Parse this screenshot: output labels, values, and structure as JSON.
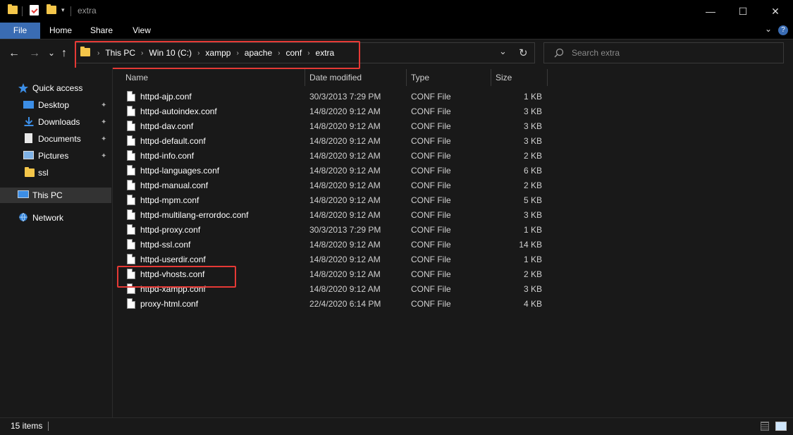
{
  "window": {
    "title": "extra",
    "minimize_glyph": "—",
    "maximize_glyph": "☐",
    "close_glyph": "✕"
  },
  "ribbon": {
    "tabs": [
      "File",
      "Home",
      "Share",
      "View"
    ],
    "expand_glyph": "⌄",
    "help_glyph": "?"
  },
  "address": {
    "crumbs": [
      "This PC",
      "Win 10 (C:)",
      "xampp",
      "apache",
      "conf",
      "extra"
    ],
    "refresh_glyph": "↻",
    "dropdown_glyph": "⌄"
  },
  "search": {
    "placeholder": "Search extra"
  },
  "nav": {
    "back": "←",
    "forward": "→",
    "recent": "⌄",
    "up": "↑"
  },
  "sidebar": {
    "quick_access": "Quick access",
    "items": [
      {
        "label": "Desktop",
        "icon": "desktop-icon",
        "pinned": true
      },
      {
        "label": "Downloads",
        "icon": "downloads-icon",
        "pinned": true
      },
      {
        "label": "Documents",
        "icon": "documents-icon",
        "pinned": true
      },
      {
        "label": "Pictures",
        "icon": "pictures-icon",
        "pinned": true
      },
      {
        "label": "ssl",
        "icon": "folder-icon",
        "pinned": false
      }
    ],
    "this_pc": "This PC",
    "network": "Network",
    "pin_glyph": "📌"
  },
  "columns": {
    "name": "Name",
    "date": "Date modified",
    "type": "Type",
    "size": "Size"
  },
  "files": [
    {
      "name": "httpd-ajp.conf",
      "date": "30/3/2013 7:29 PM",
      "type": "CONF File",
      "size": "1 KB"
    },
    {
      "name": "httpd-autoindex.conf",
      "date": "14/8/2020 9:12 AM",
      "type": "CONF File",
      "size": "3 KB"
    },
    {
      "name": "httpd-dav.conf",
      "date": "14/8/2020 9:12 AM",
      "type": "CONF File",
      "size": "3 KB"
    },
    {
      "name": "httpd-default.conf",
      "date": "14/8/2020 9:12 AM",
      "type": "CONF File",
      "size": "3 KB"
    },
    {
      "name": "httpd-info.conf",
      "date": "14/8/2020 9:12 AM",
      "type": "CONF File",
      "size": "2 KB"
    },
    {
      "name": "httpd-languages.conf",
      "date": "14/8/2020 9:12 AM",
      "type": "CONF File",
      "size": "6 KB"
    },
    {
      "name": "httpd-manual.conf",
      "date": "14/8/2020 9:12 AM",
      "type": "CONF File",
      "size": "2 KB"
    },
    {
      "name": "httpd-mpm.conf",
      "date": "14/8/2020 9:12 AM",
      "type": "CONF File",
      "size": "5 KB"
    },
    {
      "name": "httpd-multilang-errordoc.conf",
      "date": "14/8/2020 9:12 AM",
      "type": "CONF File",
      "size": "3 KB"
    },
    {
      "name": "httpd-proxy.conf",
      "date": "30/3/2013 7:29 PM",
      "type": "CONF File",
      "size": "1 KB"
    },
    {
      "name": "httpd-ssl.conf",
      "date": "14/8/2020 9:12 AM",
      "type": "CONF File",
      "size": "14 KB"
    },
    {
      "name": "httpd-userdir.conf",
      "date": "14/8/2020 9:12 AM",
      "type": "CONF File",
      "size": "1 KB"
    },
    {
      "name": "httpd-vhosts.conf",
      "date": "14/8/2020 9:12 AM",
      "type": "CONF File",
      "size": "2 KB"
    },
    {
      "name": "httpd-xampp.conf",
      "date": "14/8/2020 9:12 AM",
      "type": "CONF File",
      "size": "3 KB"
    },
    {
      "name": "proxy-html.conf",
      "date": "22/4/2020 6:14 PM",
      "type": "CONF File",
      "size": "4 KB"
    }
  ],
  "status": {
    "count": "15 items"
  },
  "colors": {
    "accent": "#3a6cb3",
    "highlight": "#e53935",
    "folder": "#f4c64a"
  }
}
